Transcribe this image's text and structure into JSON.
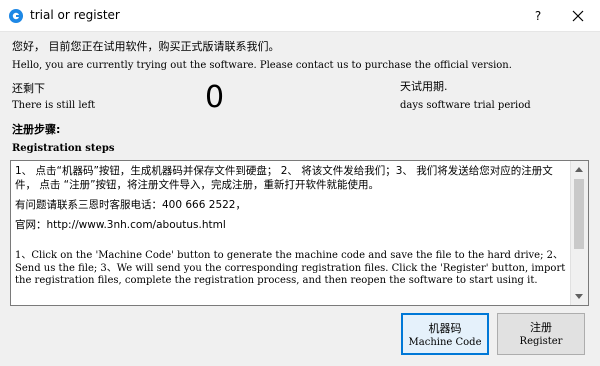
{
  "window": {
    "title": "trial or register",
    "help_glyph": "?",
    "close_glyph": "✕"
  },
  "intro": {
    "cn": "您好，  目前您正在试用软件，购买正式版请联系我们。",
    "en": "Hello, you are currently trying out the software. Please contact us to purchase the official version."
  },
  "trial": {
    "left_cn": "还剩下",
    "left_en": "There is still left",
    "days": "0",
    "period_cn": "天试用期.",
    "period_en": "days software trial period"
  },
  "registration": {
    "heading_cn": "注册步骤:",
    "heading_en": "Registration steps",
    "steps_cn": "1、 点击“机器码”按钮，生成机器码并保存文件到硬盘； 2、 将该文件发给我们；3、 我们将发送给您对应的注册文件，  点击  “注册”按钮，将注册文件导入，完成注册，重新打开软件就能使用。",
    "phone_cn": "有问题请联系三恩时客服电话：400 666 2522，",
    "website_cn": "官网：http://www.3nh.com/aboutus.html",
    "steps_en": "1、Click on the 'Machine Code' button to generate the machine code and save the file to the hard drive; 2、Send us the file; 3、We will send you the corresponding registration files. Click the 'Register' button, import the registration files, complete the registration process, and then reopen the software to start using it."
  },
  "buttons": {
    "machine_code_cn": "机器码",
    "machine_code_en": "Machine Code",
    "register_cn": "注册",
    "register_en": "Register"
  },
  "colors": {
    "accent": "#0078d7",
    "window_bg": "#f0f0f0"
  }
}
